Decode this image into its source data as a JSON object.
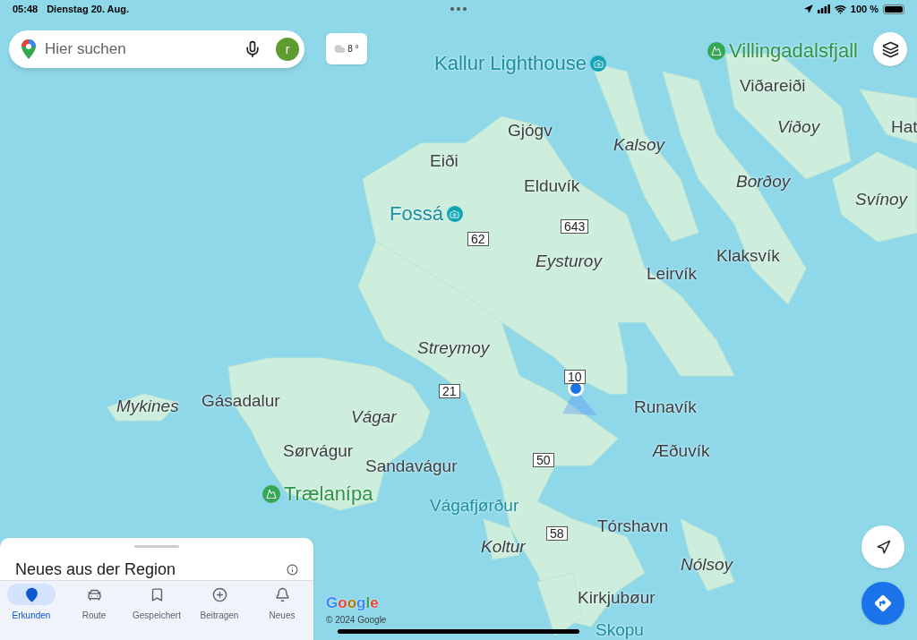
{
  "status_bar": {
    "time": "05:48",
    "date": "Dienstag 20. Aug.",
    "battery": "100 %"
  },
  "search": {
    "placeholder": "Hier suchen",
    "avatar_letter": "r"
  },
  "weather": {
    "temperature": "8 °"
  },
  "map": {
    "labels": [
      {
        "text": "Kallur Lighthouse",
        "kind": "poi"
      },
      {
        "text": "Villingadalsfjall",
        "kind": "park"
      },
      {
        "text": "Viðareiði",
        "kind": "place"
      },
      {
        "text": "Gjógv",
        "kind": "place"
      },
      {
        "text": "Viðoy",
        "kind": "island"
      },
      {
        "text": "Hat",
        "kind": "place"
      },
      {
        "text": "Kalsoy",
        "kind": "island"
      },
      {
        "text": "Eiði",
        "kind": "place"
      },
      {
        "text": "Elduvík",
        "kind": "place"
      },
      {
        "text": "Borðoy",
        "kind": "island"
      },
      {
        "text": "Fossá",
        "kind": "poi"
      },
      {
        "text": "Svínoy",
        "kind": "island"
      },
      {
        "text": "62",
        "kind": "road"
      },
      {
        "text": "643",
        "kind": "road"
      },
      {
        "text": "Eysturoy",
        "kind": "island"
      },
      {
        "text": "Leirvík",
        "kind": "place"
      },
      {
        "text": "Klaksvík",
        "kind": "place"
      },
      {
        "text": "Streymoy",
        "kind": "island"
      },
      {
        "text": "10",
        "kind": "road"
      },
      {
        "text": "21",
        "kind": "road"
      },
      {
        "text": "Mykines",
        "kind": "island"
      },
      {
        "text": "Gásadalur",
        "kind": "place"
      },
      {
        "text": "Vágar",
        "kind": "island"
      },
      {
        "text": "Runavík",
        "kind": "place"
      },
      {
        "text": "Sørvágur",
        "kind": "place"
      },
      {
        "text": "Sandavágur",
        "kind": "place"
      },
      {
        "text": "50",
        "kind": "road"
      },
      {
        "text": "Æðuvík",
        "kind": "place"
      },
      {
        "text": "Trælanípa",
        "kind": "park"
      },
      {
        "text": "Vágafjørður",
        "kind": "water"
      },
      {
        "text": "Koltur",
        "kind": "island"
      },
      {
        "text": "58",
        "kind": "road"
      },
      {
        "text": "Tórshavn",
        "kind": "place"
      },
      {
        "text": "Nólsoy",
        "kind": "island"
      },
      {
        "text": "Kirkjubøur",
        "kind": "place"
      },
      {
        "text": "Skopu",
        "kind": "water"
      }
    ],
    "logo": "Google",
    "attribution": "© 2024 Google"
  },
  "sheet": {
    "title": "Neues aus der Region"
  },
  "nav": [
    {
      "label": "Erkunden",
      "selected": true,
      "kind": "explore"
    },
    {
      "label": "Route",
      "selected": false,
      "kind": "route"
    },
    {
      "label": "Gespeichert",
      "selected": false,
      "kind": "saved"
    },
    {
      "label": "Beitragen",
      "selected": false,
      "kind": "contribute"
    },
    {
      "label": "Neues",
      "selected": false,
      "kind": "updates"
    }
  ]
}
